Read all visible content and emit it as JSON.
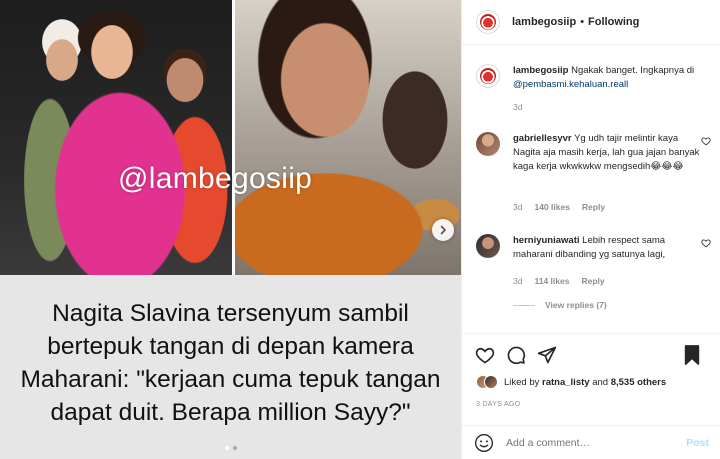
{
  "post": {
    "watermark": "@lambegosiip",
    "caption_lines": [
      "Nagita Slavina tersenyum sambil",
      "bertepuk tangan di depan kamera",
      "Maharani: \"kerjaan cuma tepuk tangan",
      "dapat duit. Berapa million Sayy?\""
    ],
    "carousel": {
      "total": 2,
      "active": 1
    }
  },
  "header": {
    "username": "lambegosiip",
    "separator": "•",
    "follow_label": "Following"
  },
  "comments": [
    {
      "username": "lambegosiip",
      "text": " Ngakak banget. Ingkapnya di ",
      "mention": "@pembasmi.kehaluan.reall",
      "time": "3d",
      "avatar": "brand-avatar"
    },
    {
      "username": "gabriellesyvr",
      "text": " Yg udh tajir melintir kaya Nagita aja masih kerja, lah gua jajan banyak kaga kerja wkwkwkw mengsedih😂😂😂",
      "time": "3d",
      "likes": "140 likes",
      "reply": "Reply",
      "avatar": "user-avatar"
    },
    {
      "username": "herniyuniawati",
      "text": " Lebih respect sama maharani dibanding yg satunya lagi,",
      "time": "3d",
      "likes": "114 likes",
      "reply": "Reply",
      "view_replies": "View replies (7)",
      "avatar": "user-avatar"
    }
  ],
  "likes": {
    "prefix": "Liked by ",
    "user": "ratna_listy",
    "middle": " and ",
    "count": "8,535 others"
  },
  "date": "3 DAYS AGO",
  "add_comment": {
    "placeholder": "Add a comment…",
    "post_label": "Post"
  },
  "colors": {
    "link": "#00376b",
    "post_disabled": "#b2dffc",
    "caption_bg": "#e6e6e6",
    "muted": "#8e8e8e"
  }
}
